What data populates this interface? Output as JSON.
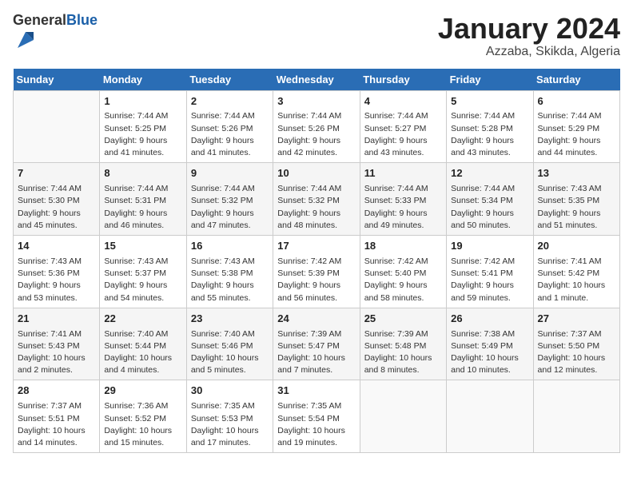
{
  "header": {
    "logo_general": "General",
    "logo_blue": "Blue",
    "title": "January 2024",
    "location": "Azzaba, Skikda, Algeria"
  },
  "days_of_week": [
    "Sunday",
    "Monday",
    "Tuesday",
    "Wednesday",
    "Thursday",
    "Friday",
    "Saturday"
  ],
  "weeks": [
    [
      {
        "day": "",
        "info": ""
      },
      {
        "day": "1",
        "info": "Sunrise: 7:44 AM\nSunset: 5:25 PM\nDaylight: 9 hours\nand 41 minutes."
      },
      {
        "day": "2",
        "info": "Sunrise: 7:44 AM\nSunset: 5:26 PM\nDaylight: 9 hours\nand 41 minutes."
      },
      {
        "day": "3",
        "info": "Sunrise: 7:44 AM\nSunset: 5:26 PM\nDaylight: 9 hours\nand 42 minutes."
      },
      {
        "day": "4",
        "info": "Sunrise: 7:44 AM\nSunset: 5:27 PM\nDaylight: 9 hours\nand 43 minutes."
      },
      {
        "day": "5",
        "info": "Sunrise: 7:44 AM\nSunset: 5:28 PM\nDaylight: 9 hours\nand 43 minutes."
      },
      {
        "day": "6",
        "info": "Sunrise: 7:44 AM\nSunset: 5:29 PM\nDaylight: 9 hours\nand 44 minutes."
      }
    ],
    [
      {
        "day": "7",
        "info": "Sunrise: 7:44 AM\nSunset: 5:30 PM\nDaylight: 9 hours\nand 45 minutes."
      },
      {
        "day": "8",
        "info": "Sunrise: 7:44 AM\nSunset: 5:31 PM\nDaylight: 9 hours\nand 46 minutes."
      },
      {
        "day": "9",
        "info": "Sunrise: 7:44 AM\nSunset: 5:32 PM\nDaylight: 9 hours\nand 47 minutes."
      },
      {
        "day": "10",
        "info": "Sunrise: 7:44 AM\nSunset: 5:32 PM\nDaylight: 9 hours\nand 48 minutes."
      },
      {
        "day": "11",
        "info": "Sunrise: 7:44 AM\nSunset: 5:33 PM\nDaylight: 9 hours\nand 49 minutes."
      },
      {
        "day": "12",
        "info": "Sunrise: 7:44 AM\nSunset: 5:34 PM\nDaylight: 9 hours\nand 50 minutes."
      },
      {
        "day": "13",
        "info": "Sunrise: 7:43 AM\nSunset: 5:35 PM\nDaylight: 9 hours\nand 51 minutes."
      }
    ],
    [
      {
        "day": "14",
        "info": "Sunrise: 7:43 AM\nSunset: 5:36 PM\nDaylight: 9 hours\nand 53 minutes."
      },
      {
        "day": "15",
        "info": "Sunrise: 7:43 AM\nSunset: 5:37 PM\nDaylight: 9 hours\nand 54 minutes."
      },
      {
        "day": "16",
        "info": "Sunrise: 7:43 AM\nSunset: 5:38 PM\nDaylight: 9 hours\nand 55 minutes."
      },
      {
        "day": "17",
        "info": "Sunrise: 7:42 AM\nSunset: 5:39 PM\nDaylight: 9 hours\nand 56 minutes."
      },
      {
        "day": "18",
        "info": "Sunrise: 7:42 AM\nSunset: 5:40 PM\nDaylight: 9 hours\nand 58 minutes."
      },
      {
        "day": "19",
        "info": "Sunrise: 7:42 AM\nSunset: 5:41 PM\nDaylight: 9 hours\nand 59 minutes."
      },
      {
        "day": "20",
        "info": "Sunrise: 7:41 AM\nSunset: 5:42 PM\nDaylight: 10 hours\nand 1 minute."
      }
    ],
    [
      {
        "day": "21",
        "info": "Sunrise: 7:41 AM\nSunset: 5:43 PM\nDaylight: 10 hours\nand 2 minutes."
      },
      {
        "day": "22",
        "info": "Sunrise: 7:40 AM\nSunset: 5:44 PM\nDaylight: 10 hours\nand 4 minutes."
      },
      {
        "day": "23",
        "info": "Sunrise: 7:40 AM\nSunset: 5:46 PM\nDaylight: 10 hours\nand 5 minutes."
      },
      {
        "day": "24",
        "info": "Sunrise: 7:39 AM\nSunset: 5:47 PM\nDaylight: 10 hours\nand 7 minutes."
      },
      {
        "day": "25",
        "info": "Sunrise: 7:39 AM\nSunset: 5:48 PM\nDaylight: 10 hours\nand 8 minutes."
      },
      {
        "day": "26",
        "info": "Sunrise: 7:38 AM\nSunset: 5:49 PM\nDaylight: 10 hours\nand 10 minutes."
      },
      {
        "day": "27",
        "info": "Sunrise: 7:37 AM\nSunset: 5:50 PM\nDaylight: 10 hours\nand 12 minutes."
      }
    ],
    [
      {
        "day": "28",
        "info": "Sunrise: 7:37 AM\nSunset: 5:51 PM\nDaylight: 10 hours\nand 14 minutes."
      },
      {
        "day": "29",
        "info": "Sunrise: 7:36 AM\nSunset: 5:52 PM\nDaylight: 10 hours\nand 15 minutes."
      },
      {
        "day": "30",
        "info": "Sunrise: 7:35 AM\nSunset: 5:53 PM\nDaylight: 10 hours\nand 17 minutes."
      },
      {
        "day": "31",
        "info": "Sunrise: 7:35 AM\nSunset: 5:54 PM\nDaylight: 10 hours\nand 19 minutes."
      },
      {
        "day": "",
        "info": ""
      },
      {
        "day": "",
        "info": ""
      },
      {
        "day": "",
        "info": ""
      }
    ]
  ]
}
